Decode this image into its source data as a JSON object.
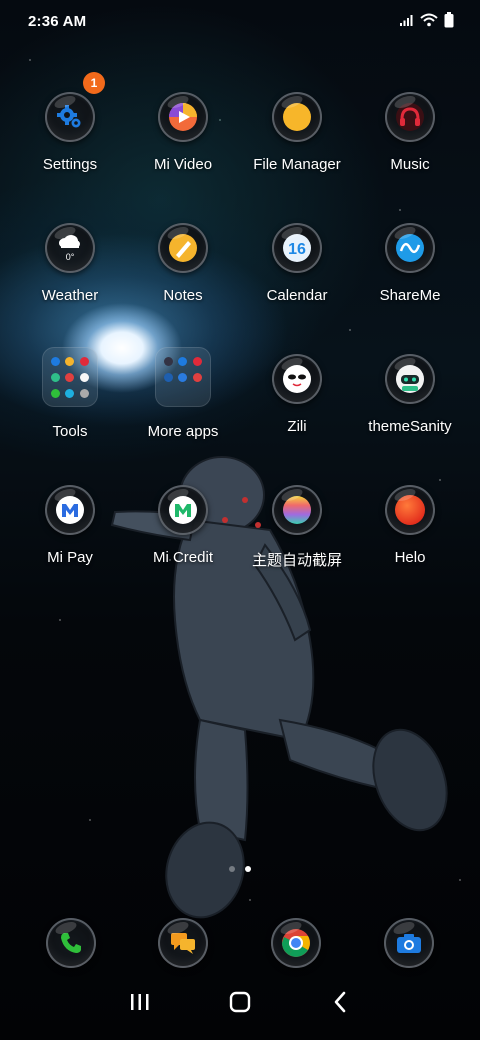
{
  "status_bar": {
    "time": "2:36 AM",
    "icons": [
      "signal-icon",
      "wifi-icon",
      "battery-icon"
    ]
  },
  "apps": [
    {
      "name": "settings",
      "label": "Settings",
      "icon": "gear-icon",
      "badge": "1"
    },
    {
      "name": "mi-video",
      "label": "Mi Video",
      "icon": "play-icon"
    },
    {
      "name": "file-manager",
      "label": "File Manager",
      "icon": "folder-icon"
    },
    {
      "name": "music",
      "label": "Music",
      "icon": "headphones-icon"
    },
    {
      "name": "weather",
      "label": "Weather",
      "icon": "cloud-icon",
      "icon_text": "0°"
    },
    {
      "name": "notes",
      "label": "Notes",
      "icon": "pencil-icon"
    },
    {
      "name": "calendar",
      "label": "Calendar",
      "icon": "calendar-icon",
      "icon_text": "16"
    },
    {
      "name": "shareme",
      "label": "ShareMe",
      "icon": "wave-icon"
    },
    {
      "name": "tools",
      "label": "Tools",
      "icon": "folder-grid-icon"
    },
    {
      "name": "more-apps",
      "label": "More apps",
      "icon": "folder-grid-icon"
    },
    {
      "name": "zili",
      "label": "Zili",
      "icon": "face-icon"
    },
    {
      "name": "themesanity",
      "label": "themeSanity",
      "icon": "robot-icon"
    },
    {
      "name": "mi-pay",
      "label": "Mi Pay",
      "icon": "mi-pay-icon"
    },
    {
      "name": "mi-credit",
      "label": "Mi Credit",
      "icon": "mi-credit-icon"
    },
    {
      "name": "theme-screenshot",
      "label": "主题自动截屏",
      "icon": "rainbow-icon"
    },
    {
      "name": "helo",
      "label": "Helo",
      "icon": "red-circle-icon"
    }
  ],
  "dock": [
    {
      "name": "phone",
      "icon": "phone-icon"
    },
    {
      "name": "messages",
      "icon": "chat-icon"
    },
    {
      "name": "chrome",
      "icon": "chrome-icon"
    },
    {
      "name": "camera",
      "icon": "camera-icon"
    }
  ],
  "page_indicator": {
    "pages": 2,
    "active": 2
  },
  "colors": {
    "badge": "#f26a1b",
    "label": "#ffffff",
    "mi_video": "#8a4bd6",
    "file_manager": "#f7b62a",
    "music": "#e02a3a",
    "notes": "#f5b42d",
    "calendar": "#1e88e5",
    "shareme": "#1e9be8",
    "phone": "#2fbf3a",
    "messages": "#f39a1e",
    "camera": "#1e7be0",
    "helo": "#f04423"
  },
  "nav_bar": {
    "icons": [
      "recent-apps-icon",
      "home-icon",
      "back-icon"
    ]
  }
}
